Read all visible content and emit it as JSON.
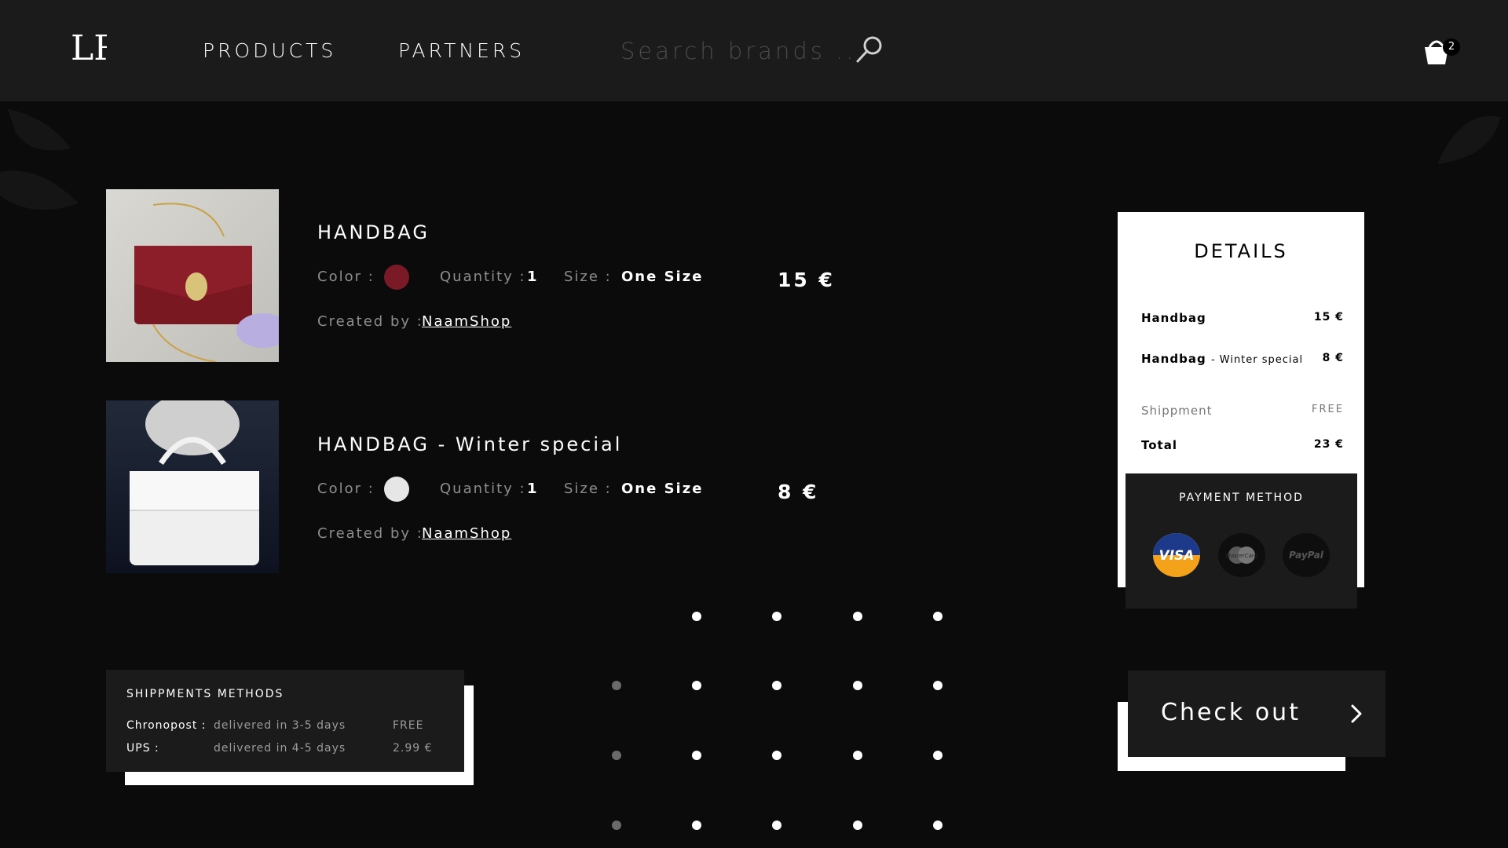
{
  "header": {
    "logo_text": "LR",
    "nav": [
      {
        "label": "PRODUCTS"
      },
      {
        "label": "PARTNERS"
      }
    ],
    "search_placeholder": "Search brands ...",
    "cart_count": "2"
  },
  "products": [
    {
      "title": "HANDBAG",
      "color_label": "Color :",
      "color_hex": "#7a1a26",
      "quantity_label": "Quantity :",
      "quantity": "1",
      "size_label": "Size :",
      "size": "One Size",
      "price": "15 €",
      "created_label": "Created by :",
      "creator": "NaamShop"
    },
    {
      "title": "HANDBAG - Winter special",
      "color_label": "Color :",
      "color_hex": "#e6e6e6",
      "quantity_label": "Quantity :",
      "quantity": "1",
      "size_label": "Size :",
      "size": "One Size",
      "price": "8 €",
      "created_label": "Created by :",
      "creator": "NaamShop"
    }
  ],
  "details": {
    "title": "DETAILS",
    "items": [
      {
        "name": "Handbag",
        "sub": "",
        "price": "15 €"
      },
      {
        "name": "Handbag",
        "sub": "- Winter special",
        "price": "8 €"
      }
    ],
    "shipment_label": "Shippment",
    "shipment_value": "FREE",
    "total_label": "Total",
    "total_value": "23 €",
    "payment_title": "PAYMENT METHOD",
    "payment_methods": [
      "VISA",
      "MasterCard",
      "PayPal"
    ]
  },
  "shipping": {
    "title": "SHIPPMENTS METHODS",
    "rows": [
      {
        "carrier": "Chronopost :",
        "desc": "delivered in 3-5 days",
        "price": "FREE"
      },
      {
        "carrier": "UPS :",
        "desc": "delivered in 4-5 days",
        "price": "2.99 €"
      }
    ]
  },
  "checkout": {
    "label": "Check out"
  },
  "colors": {
    "header_bg": "#1b1b1b",
    "page_bg": "#0b0b0b",
    "panel_bg": "#ffffff"
  }
}
